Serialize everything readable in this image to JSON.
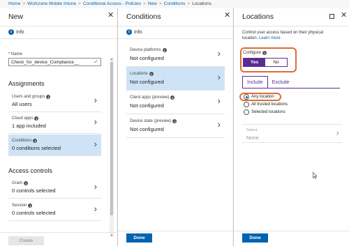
{
  "breadcrumb": {
    "items": [
      "Home",
      "Workzone Mobile Intune",
      "Conditional Access - Policies",
      "New",
      "Conditions",
      "Locations"
    ]
  },
  "blade_new": {
    "title": "New",
    "info_label": "Info",
    "name_label": "Name",
    "name_value": "Check_for_device_Compliance__",
    "assignments_heading": "Assignments",
    "access_controls_heading": "Access controls",
    "rows": [
      {
        "label": "Users and groups",
        "value": "All users"
      },
      {
        "label": "Cloud apps",
        "value": "1 app included"
      },
      {
        "label": "Conditions",
        "value": "0 conditions selected"
      },
      {
        "label": "Grant",
        "value": "0 controls selected"
      },
      {
        "label": "Session",
        "value": "0 controls selected"
      }
    ],
    "create_button": "Create"
  },
  "blade_conditions": {
    "title": "Conditions",
    "info_label": "Info",
    "rows": [
      {
        "label": "Device platforms",
        "value": "Not configured"
      },
      {
        "label": "Locations",
        "value": "Not configured"
      },
      {
        "label": "Client apps (preview)",
        "value": "Not configured"
      },
      {
        "label": "Device state (preview)",
        "value": "Not configured"
      }
    ],
    "done_button": "Done"
  },
  "blade_locations": {
    "title": "Locations",
    "description": "Control user access based on their physical location.",
    "learn_more": "Learn more",
    "configure_label": "Configure",
    "toggle_yes": "Yes",
    "toggle_no": "No",
    "tab_include": "Include",
    "tab_exclude": "Exclude",
    "radios": [
      "Any location",
      "All trusted locations",
      "Selected locations"
    ],
    "select_label": "Select",
    "select_value": "None",
    "done_button": "Done"
  },
  "colors": {
    "accent_blue": "#0063b1",
    "toggle_purple": "#5c2d91",
    "highlight_orange": "#e06b31",
    "selected_row": "#cfe3f7"
  }
}
